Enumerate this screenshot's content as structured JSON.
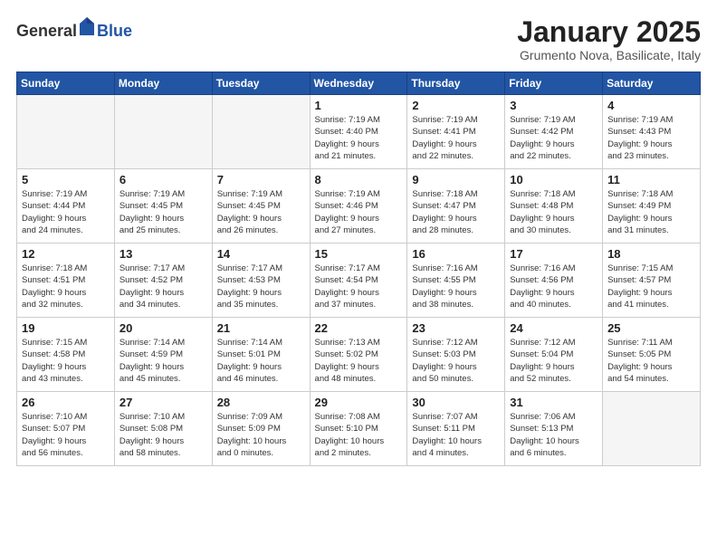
{
  "header": {
    "logo_general": "General",
    "logo_blue": "Blue",
    "month_title": "January 2025",
    "subtitle": "Grumento Nova, Basilicate, Italy"
  },
  "days_of_week": [
    "Sunday",
    "Monday",
    "Tuesday",
    "Wednesday",
    "Thursday",
    "Friday",
    "Saturday"
  ],
  "weeks": [
    {
      "days": [
        {
          "num": "",
          "detail": "",
          "empty": true
        },
        {
          "num": "",
          "detail": "",
          "empty": true
        },
        {
          "num": "",
          "detail": "",
          "empty": true
        },
        {
          "num": "1",
          "detail": "Sunrise: 7:19 AM\nSunset: 4:40 PM\nDaylight: 9 hours\nand 21 minutes.",
          "empty": false
        },
        {
          "num": "2",
          "detail": "Sunrise: 7:19 AM\nSunset: 4:41 PM\nDaylight: 9 hours\nand 22 minutes.",
          "empty": false
        },
        {
          "num": "3",
          "detail": "Sunrise: 7:19 AM\nSunset: 4:42 PM\nDaylight: 9 hours\nand 22 minutes.",
          "empty": false
        },
        {
          "num": "4",
          "detail": "Sunrise: 7:19 AM\nSunset: 4:43 PM\nDaylight: 9 hours\nand 23 minutes.",
          "empty": false
        }
      ]
    },
    {
      "days": [
        {
          "num": "5",
          "detail": "Sunrise: 7:19 AM\nSunset: 4:44 PM\nDaylight: 9 hours\nand 24 minutes.",
          "empty": false
        },
        {
          "num": "6",
          "detail": "Sunrise: 7:19 AM\nSunset: 4:45 PM\nDaylight: 9 hours\nand 25 minutes.",
          "empty": false
        },
        {
          "num": "7",
          "detail": "Sunrise: 7:19 AM\nSunset: 4:45 PM\nDaylight: 9 hours\nand 26 minutes.",
          "empty": false
        },
        {
          "num": "8",
          "detail": "Sunrise: 7:19 AM\nSunset: 4:46 PM\nDaylight: 9 hours\nand 27 minutes.",
          "empty": false
        },
        {
          "num": "9",
          "detail": "Sunrise: 7:18 AM\nSunset: 4:47 PM\nDaylight: 9 hours\nand 28 minutes.",
          "empty": false
        },
        {
          "num": "10",
          "detail": "Sunrise: 7:18 AM\nSunset: 4:48 PM\nDaylight: 9 hours\nand 30 minutes.",
          "empty": false
        },
        {
          "num": "11",
          "detail": "Sunrise: 7:18 AM\nSunset: 4:49 PM\nDaylight: 9 hours\nand 31 minutes.",
          "empty": false
        }
      ]
    },
    {
      "days": [
        {
          "num": "12",
          "detail": "Sunrise: 7:18 AM\nSunset: 4:51 PM\nDaylight: 9 hours\nand 32 minutes.",
          "empty": false
        },
        {
          "num": "13",
          "detail": "Sunrise: 7:17 AM\nSunset: 4:52 PM\nDaylight: 9 hours\nand 34 minutes.",
          "empty": false
        },
        {
          "num": "14",
          "detail": "Sunrise: 7:17 AM\nSunset: 4:53 PM\nDaylight: 9 hours\nand 35 minutes.",
          "empty": false
        },
        {
          "num": "15",
          "detail": "Sunrise: 7:17 AM\nSunset: 4:54 PM\nDaylight: 9 hours\nand 37 minutes.",
          "empty": false
        },
        {
          "num": "16",
          "detail": "Sunrise: 7:16 AM\nSunset: 4:55 PM\nDaylight: 9 hours\nand 38 minutes.",
          "empty": false
        },
        {
          "num": "17",
          "detail": "Sunrise: 7:16 AM\nSunset: 4:56 PM\nDaylight: 9 hours\nand 40 minutes.",
          "empty": false
        },
        {
          "num": "18",
          "detail": "Sunrise: 7:15 AM\nSunset: 4:57 PM\nDaylight: 9 hours\nand 41 minutes.",
          "empty": false
        }
      ]
    },
    {
      "days": [
        {
          "num": "19",
          "detail": "Sunrise: 7:15 AM\nSunset: 4:58 PM\nDaylight: 9 hours\nand 43 minutes.",
          "empty": false
        },
        {
          "num": "20",
          "detail": "Sunrise: 7:14 AM\nSunset: 4:59 PM\nDaylight: 9 hours\nand 45 minutes.",
          "empty": false
        },
        {
          "num": "21",
          "detail": "Sunrise: 7:14 AM\nSunset: 5:01 PM\nDaylight: 9 hours\nand 46 minutes.",
          "empty": false
        },
        {
          "num": "22",
          "detail": "Sunrise: 7:13 AM\nSunset: 5:02 PM\nDaylight: 9 hours\nand 48 minutes.",
          "empty": false
        },
        {
          "num": "23",
          "detail": "Sunrise: 7:12 AM\nSunset: 5:03 PM\nDaylight: 9 hours\nand 50 minutes.",
          "empty": false
        },
        {
          "num": "24",
          "detail": "Sunrise: 7:12 AM\nSunset: 5:04 PM\nDaylight: 9 hours\nand 52 minutes.",
          "empty": false
        },
        {
          "num": "25",
          "detail": "Sunrise: 7:11 AM\nSunset: 5:05 PM\nDaylight: 9 hours\nand 54 minutes.",
          "empty": false
        }
      ]
    },
    {
      "days": [
        {
          "num": "26",
          "detail": "Sunrise: 7:10 AM\nSunset: 5:07 PM\nDaylight: 9 hours\nand 56 minutes.",
          "empty": false
        },
        {
          "num": "27",
          "detail": "Sunrise: 7:10 AM\nSunset: 5:08 PM\nDaylight: 9 hours\nand 58 minutes.",
          "empty": false
        },
        {
          "num": "28",
          "detail": "Sunrise: 7:09 AM\nSunset: 5:09 PM\nDaylight: 10 hours\nand 0 minutes.",
          "empty": false
        },
        {
          "num": "29",
          "detail": "Sunrise: 7:08 AM\nSunset: 5:10 PM\nDaylight: 10 hours\nand 2 minutes.",
          "empty": false
        },
        {
          "num": "30",
          "detail": "Sunrise: 7:07 AM\nSunset: 5:11 PM\nDaylight: 10 hours\nand 4 minutes.",
          "empty": false
        },
        {
          "num": "31",
          "detail": "Sunrise: 7:06 AM\nSunset: 5:13 PM\nDaylight: 10 hours\nand 6 minutes.",
          "empty": false
        },
        {
          "num": "",
          "detail": "",
          "empty": true
        }
      ]
    }
  ]
}
